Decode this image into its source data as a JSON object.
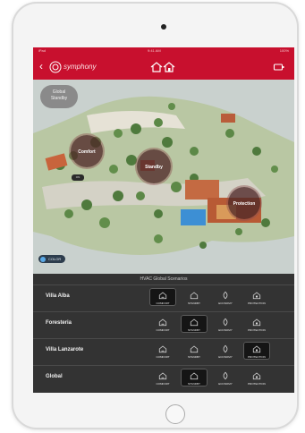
{
  "status_bar": {
    "carrier": "iPad",
    "time": "9:41 AM",
    "battery": "100%"
  },
  "header": {
    "logo_text": "symphony",
    "icons": [
      "back-icon",
      "logo-icon",
      "homes-icon",
      "power-icon"
    ]
  },
  "map": {
    "global_badge": {
      "line1": "Global",
      "line2": "Standby"
    },
    "areas": [
      {
        "label": "Comfort"
      },
      {
        "label": "Standby"
      },
      {
        "label": "Protection"
      }
    ],
    "small_chip": "ON",
    "color_toggle": "COLOR"
  },
  "panel": {
    "title": "HVAC Global Scenarios",
    "mode_labels": [
      "COMFORT",
      "STANDBY",
      "ECONOMY",
      "PROTECTION"
    ],
    "rows": [
      {
        "name": "Villa Alba",
        "selected": 0
      },
      {
        "name": "Foresteria",
        "selected": 1
      },
      {
        "name": "Villa Lanzarote",
        "selected": 3
      },
      {
        "name": "Global",
        "selected": 1
      }
    ]
  },
  "colors": {
    "brand_red": "#c8102e",
    "panel_bg": "#333333",
    "selected_bg": "#151515"
  }
}
